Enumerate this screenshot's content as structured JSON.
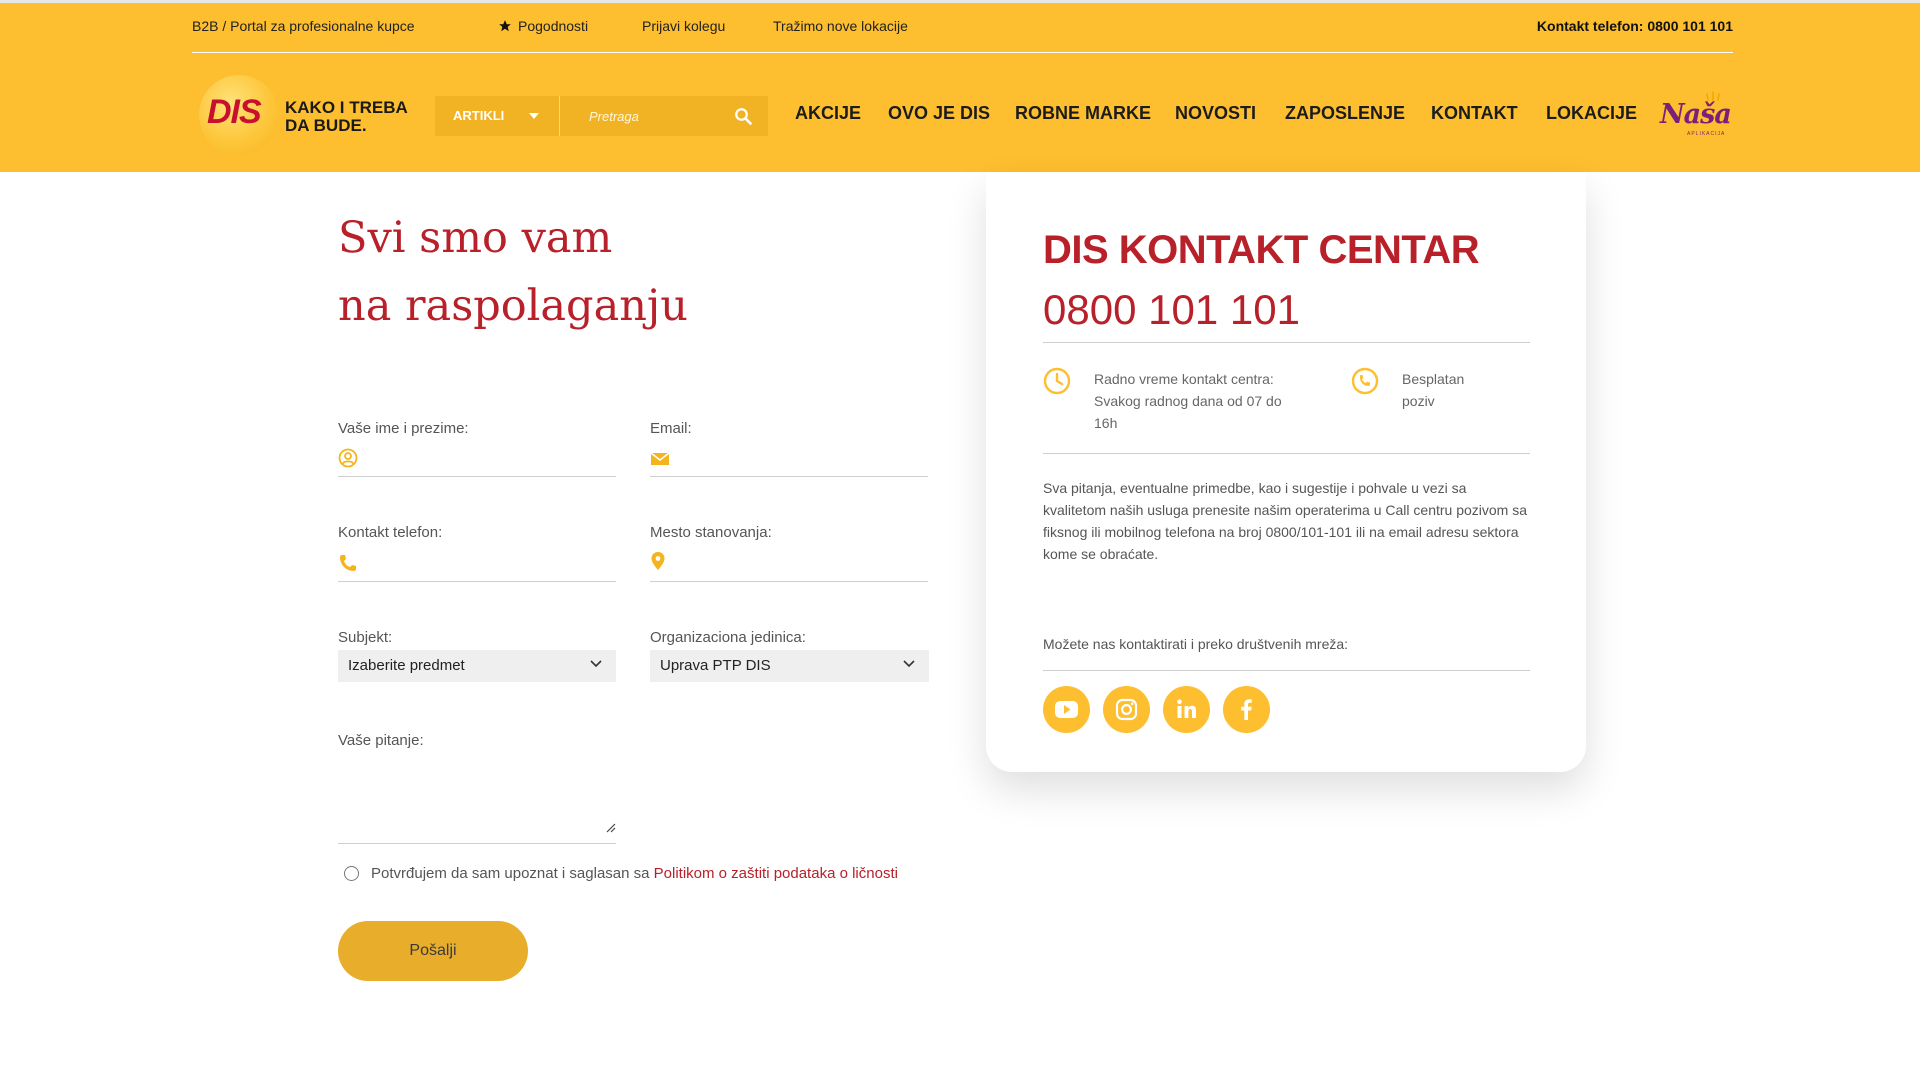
{
  "topbar": {
    "b2b": "B2B / Portal za profesionalne kupce",
    "pogodnosti": "Pogodnosti",
    "prijavi": "Prijavi kolegu",
    "lokacije": "Tražimo nove lokacije",
    "phone": "Kontakt telefon: 0800 101 101"
  },
  "logo": {
    "text": "DIS",
    "slogan_line1": "KAKO I TREBA",
    "slogan_line2": "DA BUDE."
  },
  "search": {
    "category": "ARTIKLI",
    "placeholder": "Pretraga"
  },
  "nav": [
    "AKCIJE",
    "OVO JE DIS",
    "ROBNE MARKE",
    "NOVOSTI",
    "ZAPOSLENJE",
    "KONTAKT",
    "LOKACIJE"
  ],
  "nasa": {
    "logo": "Naša",
    "sub": "APLIKACIJA"
  },
  "form": {
    "title_line1": "Svi smo vam",
    "title_line2": "na raspolaganju",
    "name_label": "Vaše ime i prezime:",
    "email_label": "Email:",
    "phone_label": "Kontakt telefon:",
    "city_label": "Mesto stanovanja:",
    "subject_label": "Subjekt:",
    "subject_value": "Izaberite predmet",
    "org_label": "Organizaciona jedinica:",
    "org_value": "Uprava PTP DIS",
    "question_label": "Vaše pitanje:",
    "consent_text": "Potvrđujem da sam upoznat i saglasan sa ",
    "consent_link": "Politikom o zaštiti podataka o ličnosti",
    "submit": "Pošalji"
  },
  "card": {
    "title": "DIS KONTAKT CENTAR",
    "phone": "0800 101 101",
    "hours_line1": "Radno vreme kontakt centra:",
    "hours_line2": "Svakog radnog dana od 07 do",
    "hours_line3": "16h",
    "free_line1": "Besplatan",
    "free_line2": "poziv",
    "desc": "Sva pitanja, eventualne primedbe, kao i sugestije i pohvale u vezi sa kvalitetom naših usluga prenesite našim operaterima u Call centru pozivom sa fiksnog ili mobilnog telefona na broj 0800/101-101 ili na email adresu sektora kome se obraćate.",
    "social_label": "Možete nas kontaktirati i preko društvenih mreža:"
  },
  "colors": {
    "brand_yellow": "#fdbe2f",
    "brand_red": "#b8202a",
    "nasa_purple": "#7a1f7c"
  }
}
